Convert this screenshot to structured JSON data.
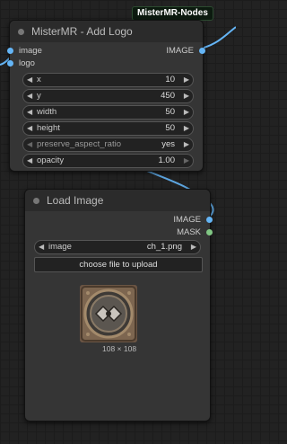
{
  "top_badge": "MisterMR-Nodes",
  "add_logo_node": {
    "title": "MisterMR - Add Logo",
    "inputs": [
      {
        "label": "image"
      },
      {
        "label": "logo"
      }
    ],
    "output_label": "IMAGE",
    "widgets": [
      {
        "label": "x",
        "value": "10"
      },
      {
        "label": "y",
        "value": "450"
      },
      {
        "label": "width",
        "value": "50"
      },
      {
        "label": "height",
        "value": "50"
      },
      {
        "label": "preserve_aspect_ratio",
        "value": "yes"
      },
      {
        "label": "opacity",
        "value": "1.00"
      }
    ]
  },
  "load_image_node": {
    "title": "Load Image",
    "outputs": [
      {
        "label": "IMAGE",
        "color": "#64b5f6"
      },
      {
        "label": "MASK",
        "color": "#81c784"
      }
    ],
    "image_widget": {
      "label": "image",
      "value": "ch_1.png"
    },
    "upload_button": "choose file to upload",
    "preview_size": "108 × 108"
  },
  "colors": {
    "image_link": "#64b5f6",
    "mask_slot": "#81c784",
    "background": "#222222"
  },
  "icons": [
    "left-arrow-icon",
    "right-arrow-icon",
    "node-collapse-dot-icon",
    "slot-dot-icon"
  ]
}
